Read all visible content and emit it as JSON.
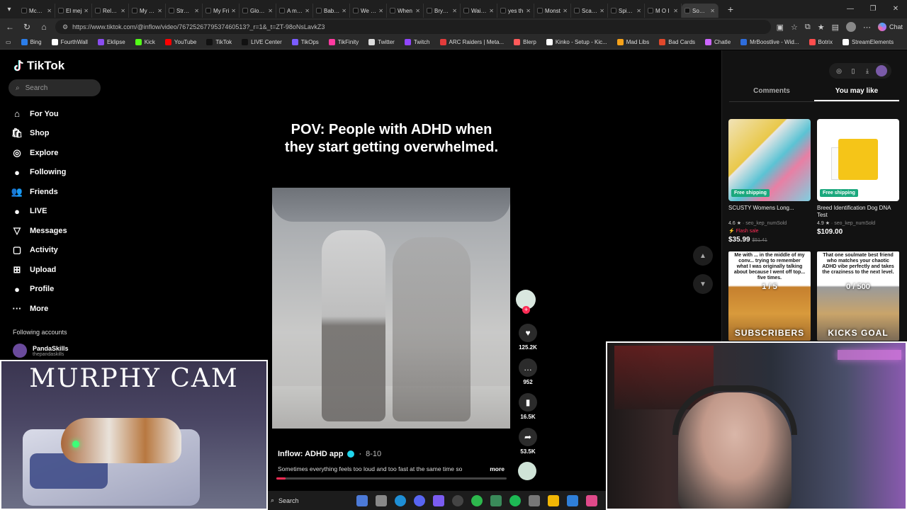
{
  "browser": {
    "tabs": [
      {
        "label": "McKinl"
      },
      {
        "label": "El mej"
      },
      {
        "label": "Relax y"
      },
      {
        "label": "My Me"
      },
      {
        "label": "Straigh"
      },
      {
        "label": "My Fri"
      },
      {
        "label": "Glow S"
      },
      {
        "label": "A man"
      },
      {
        "label": "Baby a"
      },
      {
        "label": "We lite"
      },
      {
        "label": "When"
      },
      {
        "label": "Bryan a"
      },
      {
        "label": "Wait fo"
      },
      {
        "label": "yes th"
      },
      {
        "label": "Monst"
      },
      {
        "label": "Scarin"
      },
      {
        "label": "Spider"
      },
      {
        "label": "M O I"
      },
      {
        "label": "Somet",
        "active": true
      }
    ],
    "url": "https://www.tiktok.com/@inflow/video/7672526779537460513?_r=1&_t=ZT-98oNsLavkZ3",
    "chat_label": "Chat",
    "bookmarks": [
      {
        "label": "Bing",
        "color": "#2b7de9"
      },
      {
        "label": "FourthWall",
        "color": "#ffffff"
      },
      {
        "label": "Eklipse",
        "color": "#8a4df0"
      },
      {
        "label": "Kick",
        "color": "#53fc18"
      },
      {
        "label": "YouTube",
        "color": "#ff0000"
      },
      {
        "label": "TikTok",
        "color": "#111111"
      },
      {
        "label": "LIVE Center",
        "color": "#111111"
      },
      {
        "label": "TikOps",
        "color": "#7a5cff"
      },
      {
        "label": "TikFinity",
        "color": "#ff3aa0"
      },
      {
        "label": "Twitter",
        "color": "#dddddd"
      },
      {
        "label": "Twitch",
        "color": "#9146ff"
      },
      {
        "label": "ARC Raiders | Meta...",
        "color": "#e23b3b"
      },
      {
        "label": "Blerp",
        "color": "#ff5a5a"
      },
      {
        "label": "Kinko - Setup - Kic...",
        "color": "#ffffff"
      },
      {
        "label": "Mad Libs",
        "color": "#f6a21a"
      },
      {
        "label": "Bad Cards",
        "color": "#e0482b"
      },
      {
        "label": "Chatle",
        "color": "#cc66ff"
      },
      {
        "label": "MrBoostlive - Wid...",
        "color": "#2e6ddc"
      },
      {
        "label": "Botrix",
        "color": "#ff4d4d"
      },
      {
        "label": "StreamElements",
        "color": "#ffffff"
      }
    ]
  },
  "tiktok": {
    "logo": "TikTok",
    "search_placeholder": "Search",
    "nav": [
      {
        "label": "For You",
        "icon": "home-icon",
        "glyph": "⌂"
      },
      {
        "label": "Shop",
        "icon": "shop-icon",
        "glyph": "🛍"
      },
      {
        "label": "Explore",
        "icon": "compass-icon",
        "glyph": "◎"
      },
      {
        "label": "Following",
        "icon": "following-icon",
        "glyph": "●"
      },
      {
        "label": "Friends",
        "icon": "friends-icon",
        "glyph": "👥"
      },
      {
        "label": "LIVE",
        "icon": "live-icon",
        "glyph": "●"
      },
      {
        "label": "Messages",
        "icon": "messages-icon",
        "glyph": "▽"
      },
      {
        "label": "Activity",
        "icon": "activity-icon",
        "glyph": "▢"
      },
      {
        "label": "Upload",
        "icon": "upload-icon",
        "glyph": "⊞"
      },
      {
        "label": "Profile",
        "icon": "profile-icon",
        "glyph": "●"
      },
      {
        "label": "More",
        "icon": "more-icon",
        "glyph": "···"
      }
    ],
    "following_header": "Following accounts",
    "following_account": {
      "name": "PandaSkills",
      "handle": "thepandaskills"
    }
  },
  "video": {
    "caption": "POV: People with ADHD when they start getting overwhelmed.",
    "author": "Inflow: ADHD app",
    "date": "8-10",
    "description": "Sometimes everything feels too loud and too fast at the same time so",
    "more_label": "more",
    "progress_fraction": 0.04,
    "likes": "125.2K",
    "comments": "952",
    "saves": "16.5K",
    "shares": "53.5K"
  },
  "right_panel": {
    "tabs": [
      {
        "label": "Comments"
      },
      {
        "label": "You may like",
        "active": true
      }
    ],
    "products": [
      {
        "title": "SCUSTY Womens Long...",
        "rating": "4.6",
        "sold": "seo_kep_numSold",
        "badge": "Free shipping",
        "flash": "Flash sale",
        "price": "$35.99",
        "old_price": "$51.41"
      },
      {
        "title": "Breed Identification Dog DNA Test",
        "rating": "4.9",
        "sold": "seo_kep_numSold",
        "badge": "Free shipping",
        "price": "$109.00"
      }
    ],
    "videos": [
      {
        "text": "Me with ... in the middle of my conv... trying to remember what I was originally talking about because I went off top... five times.",
        "count": "1 / 5",
        "bottom": "SUBSCRIBERS"
      },
      {
        "text": "That one soulmate best friend who matches your chaotic ADHD vibe perfectly and takes the craziness to the next level.",
        "count": "0 / 500",
        "bottom": "KICKS GOAL"
      }
    ]
  },
  "overlay": {
    "murphy_cam": "MURPHY CAM"
  },
  "taskbar": {
    "search": "Search"
  }
}
